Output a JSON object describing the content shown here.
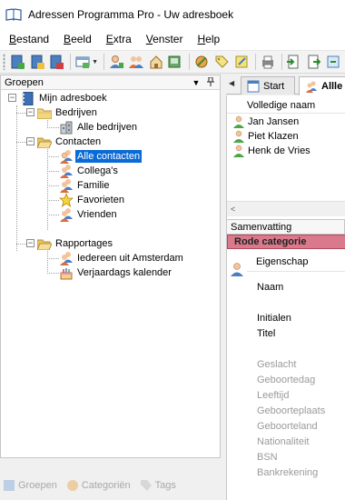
{
  "window": {
    "title": "Adressen Programma Pro - Uw adresboek"
  },
  "menu": [
    "Bestand",
    "Beeld",
    "Extra",
    "Venster",
    "Help"
  ],
  "left_pane": {
    "title": "Groepen",
    "tree": {
      "root": "Mijn adresboek",
      "bedrijven": "Bedrijven",
      "alle_bedrijven": "Alle bedrijven",
      "contacten": "Contacten",
      "alle_contacten": "Alle contacten",
      "collegas": "Collega's",
      "familie": "Familie",
      "favorieten": "Favorieten",
      "vrienden": "Vrienden",
      "rapportages": "Rapportages",
      "amsterdam": "Iedereen uit Amsterdam",
      "verjaardags": "Verjaardags kalender"
    },
    "bottom_tabs": [
      "Groepen",
      "Categoriën",
      "Tags"
    ]
  },
  "right_pane": {
    "tabs": [
      "Start",
      "Allle"
    ],
    "list": {
      "column": "Volledige naam",
      "rows": [
        "Jan Jansen",
        "Piet Klazen",
        "Henk de Vries"
      ]
    },
    "summary": {
      "title": "Samenvatting",
      "category": "Rode categorie",
      "property_header": "Eigenschap",
      "properties": [
        "Naam",
        "Initialen",
        "Titel"
      ],
      "properties_dim": [
        "Geslacht",
        "Geboortedag",
        "Leeftijd",
        "Geboorteplaats",
        "Geboorteland",
        "Nationaliteit",
        "BSN",
        "Bankrekening"
      ]
    }
  },
  "colors": {
    "selection": "#0a6bd6",
    "red_category": "#d9798b"
  }
}
